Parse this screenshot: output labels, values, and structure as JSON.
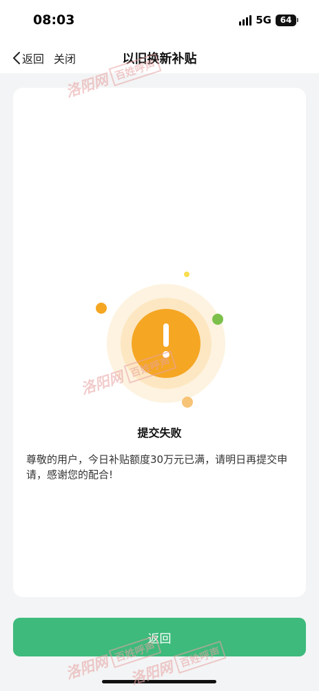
{
  "status_bar": {
    "time": "08:03",
    "network": "5G",
    "battery": "64"
  },
  "nav": {
    "back_label": "返回",
    "close_label": "关闭",
    "title": "以旧换新补贴"
  },
  "result": {
    "title": "提交失败",
    "message": "尊敬的用户，今日补贴额度30万元已满，请明日再提交申请，感谢您的配合!",
    "icon": "exclamation-icon"
  },
  "footer": {
    "button_label": "返回"
  },
  "watermark": {
    "left_text": "洛阳网",
    "right_text": "百姓呼声"
  },
  "colors": {
    "accent": "#3dba7c",
    "warning": "#f5a623",
    "background": "#f3f4f5",
    "card": "#ffffff"
  }
}
